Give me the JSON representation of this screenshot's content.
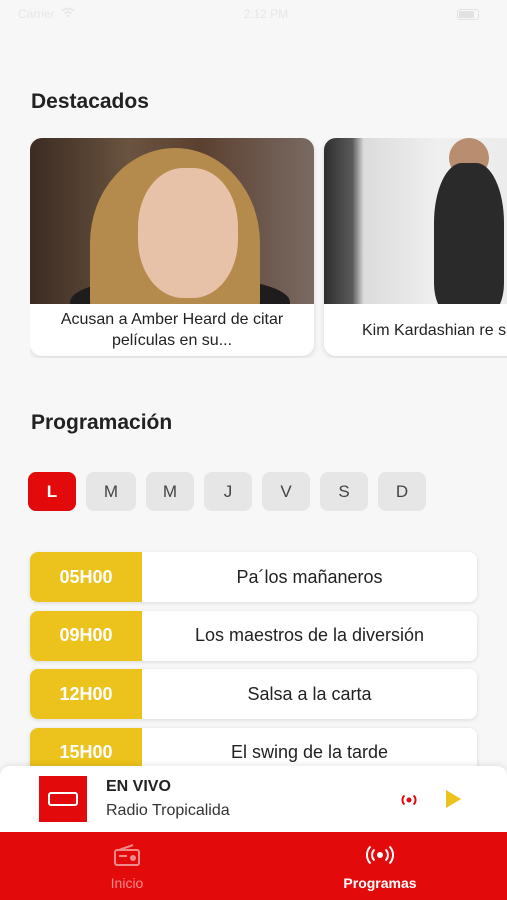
{
  "status_bar": {
    "carrier": "Carrier",
    "time": "2:12 PM"
  },
  "sections": {
    "destacados": "Destacados",
    "programacion": "Programación"
  },
  "featured": [
    {
      "caption": "Acusan a Amber Heard de citar películas en su..."
    },
    {
      "caption": "Kim Kardashian re segundo vestido M"
    }
  ],
  "days": [
    {
      "label": "L",
      "active": true
    },
    {
      "label": "M"
    },
    {
      "label": "M"
    },
    {
      "label": "J"
    },
    {
      "label": "V"
    },
    {
      "label": "S"
    },
    {
      "label": "D"
    }
  ],
  "schedule": [
    {
      "time": "05H00",
      "name": "Pa´los mañaneros"
    },
    {
      "time": "09H00",
      "name": "Los maestros de la diversión"
    },
    {
      "time": "12H00",
      "name": "Salsa a la carta"
    },
    {
      "time": "15H00",
      "name": "El swing de la tarde"
    }
  ],
  "player": {
    "live_label": "EN VIVO",
    "station": "Radio Tropicalida"
  },
  "tabs": {
    "inicio": "Inicio",
    "programas": "Programas"
  },
  "colors": {
    "brand_red": "#e20a0a",
    "accent_yellow": "#ecc21c"
  },
  "icons": {
    "tab_inicio": "radio-icon",
    "tab_programas": "broadcast-icon",
    "player_cast": "broadcast-icon",
    "player_play": "play-icon"
  }
}
